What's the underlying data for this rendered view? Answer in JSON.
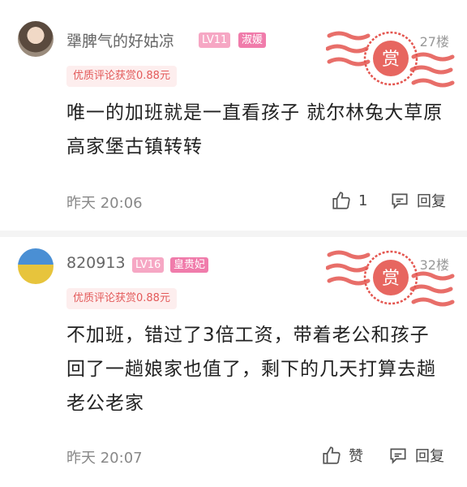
{
  "comments": [
    {
      "username": "犟脾气的好姑凉",
      "level": "LV11",
      "title_badge": "淑媛",
      "floor": "27楼",
      "reward_tag": "优质评论获赏0.88元",
      "body": "唯一的加班就是一直看孩子 就尔林兔大草原 高家堡古镇转转",
      "time": "昨天 20:06",
      "like_count": "1",
      "reply_label": "回复",
      "stamp_text": "赏"
    },
    {
      "username": "820913",
      "level": "LV16",
      "title_badge": "皇贵妃",
      "floor": "32楼",
      "reward_tag": "优质评论获赏0.88元",
      "body": "不加班，错过了3倍工资，带着老公和孩子回了一趟娘家也值了，剩下的几天打算去趟老公老家",
      "time": "昨天 20:07",
      "like_label": "赞",
      "reply_label": "回复",
      "stamp_text": "赏"
    }
  ],
  "colors": {
    "reward_text": "#e35a5a",
    "level_badge": "#f6a7c4",
    "title_badge": "#f07cab",
    "stamp": "#e4554f"
  }
}
